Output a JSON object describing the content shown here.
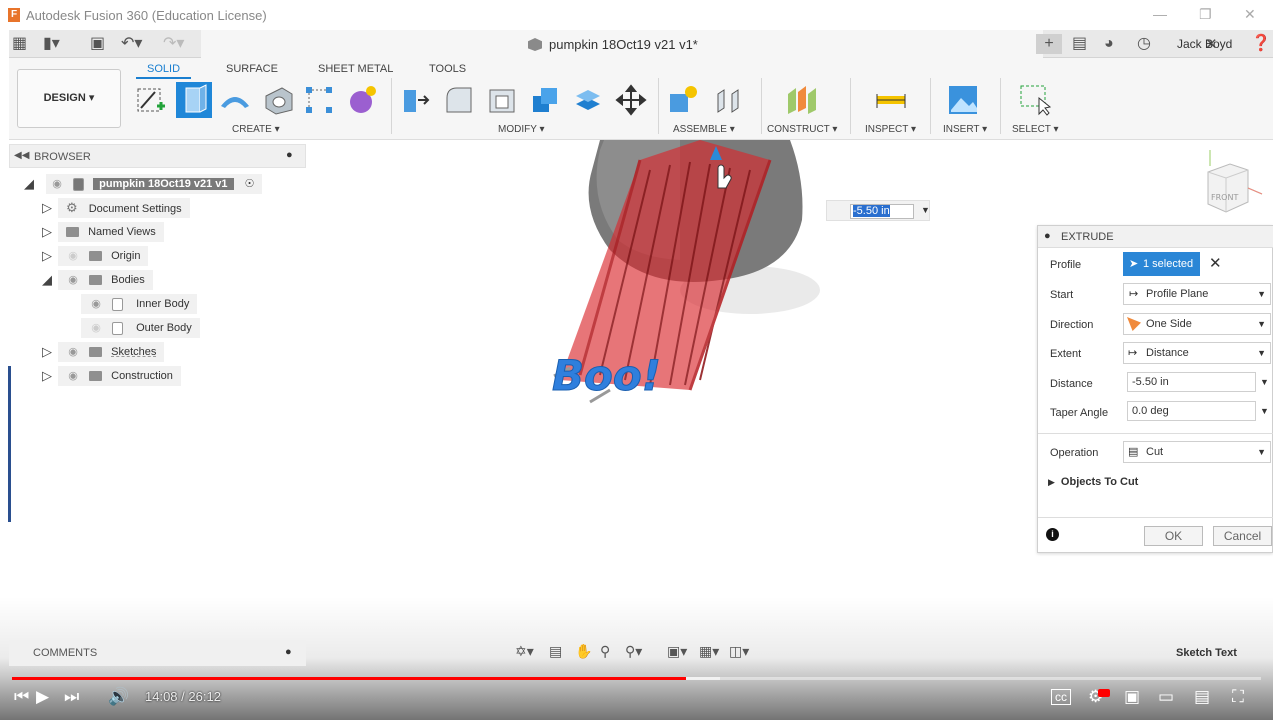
{
  "window": {
    "title": "Autodesk Fusion 360 (Education License)",
    "logo_letter": "F"
  },
  "appbar": {
    "document_title": "pumpkin 18Oct19 v21 v1*",
    "user_name": "Jack Boyd"
  },
  "ribbon": {
    "workspace": "DESIGN",
    "tabs": [
      "SOLID",
      "SURFACE",
      "SHEET METAL",
      "TOOLS"
    ],
    "groups": [
      "CREATE",
      "MODIFY",
      "ASSEMBLE",
      "CONSTRUCT",
      "INSPECT",
      "INSERT",
      "SELECT"
    ]
  },
  "browser": {
    "title": "BROWSER",
    "root": "pumpkin 18Oct19 v21 v1",
    "items": [
      {
        "label": "Document Settings"
      },
      {
        "label": "Named Views"
      },
      {
        "label": "Origin"
      },
      {
        "label": "Bodies"
      },
      {
        "label": "Inner Body"
      },
      {
        "label": "Outer Body"
      },
      {
        "label": "Sketches"
      },
      {
        "label": "Construction"
      }
    ]
  },
  "viewport": {
    "model_text": "Boo!",
    "distance_input": "-5.50 in",
    "viewcube_label": "FRONT"
  },
  "extrude": {
    "title": "EXTRUDE",
    "fields": {
      "profile": {
        "label": "Profile",
        "value": "1 selected"
      },
      "start": {
        "label": "Start",
        "value": "Profile Plane"
      },
      "direction": {
        "label": "Direction",
        "value": "One Side"
      },
      "extent": {
        "label": "Extent",
        "value": "Distance"
      },
      "distance": {
        "label": "Distance",
        "value": "-5.50 in"
      },
      "taper": {
        "label": "Taper Angle",
        "value": "0.0 deg"
      },
      "operation": {
        "label": "Operation",
        "value": "Cut"
      }
    },
    "objects_to_cut": "Objects To Cut",
    "ok_label": "OK",
    "cancel_label": "Cancel"
  },
  "bottom": {
    "comments": "COMMENTS",
    "status": "Sketch Text"
  },
  "video": {
    "current_time": "14:08",
    "duration": "26:12",
    "played_fraction": 0.54,
    "buffered_fraction": 0.567,
    "time_separator": " / "
  },
  "colors": {
    "accent": "#1a7fd0",
    "selection": "#2a86d6",
    "progress": "#ff0000",
    "cut_red": "#d9272c"
  }
}
